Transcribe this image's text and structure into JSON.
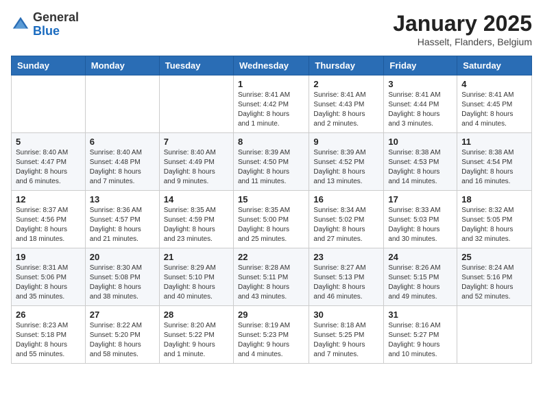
{
  "logo": {
    "general": "General",
    "blue": "Blue"
  },
  "header": {
    "title": "January 2025",
    "subtitle": "Hasselt, Flanders, Belgium"
  },
  "weekdays": [
    "Sunday",
    "Monday",
    "Tuesday",
    "Wednesday",
    "Thursday",
    "Friday",
    "Saturday"
  ],
  "weeks": [
    [
      {
        "day": "",
        "info": ""
      },
      {
        "day": "",
        "info": ""
      },
      {
        "day": "",
        "info": ""
      },
      {
        "day": "1",
        "info": "Sunrise: 8:41 AM\nSunset: 4:42 PM\nDaylight: 8 hours\nand 1 minute."
      },
      {
        "day": "2",
        "info": "Sunrise: 8:41 AM\nSunset: 4:43 PM\nDaylight: 8 hours\nand 2 minutes."
      },
      {
        "day": "3",
        "info": "Sunrise: 8:41 AM\nSunset: 4:44 PM\nDaylight: 8 hours\nand 3 minutes."
      },
      {
        "day": "4",
        "info": "Sunrise: 8:41 AM\nSunset: 4:45 PM\nDaylight: 8 hours\nand 4 minutes."
      }
    ],
    [
      {
        "day": "5",
        "info": "Sunrise: 8:40 AM\nSunset: 4:47 PM\nDaylight: 8 hours\nand 6 minutes."
      },
      {
        "day": "6",
        "info": "Sunrise: 8:40 AM\nSunset: 4:48 PM\nDaylight: 8 hours\nand 7 minutes."
      },
      {
        "day": "7",
        "info": "Sunrise: 8:40 AM\nSunset: 4:49 PM\nDaylight: 8 hours\nand 9 minutes."
      },
      {
        "day": "8",
        "info": "Sunrise: 8:39 AM\nSunset: 4:50 PM\nDaylight: 8 hours\nand 11 minutes."
      },
      {
        "day": "9",
        "info": "Sunrise: 8:39 AM\nSunset: 4:52 PM\nDaylight: 8 hours\nand 13 minutes."
      },
      {
        "day": "10",
        "info": "Sunrise: 8:38 AM\nSunset: 4:53 PM\nDaylight: 8 hours\nand 14 minutes."
      },
      {
        "day": "11",
        "info": "Sunrise: 8:38 AM\nSunset: 4:54 PM\nDaylight: 8 hours\nand 16 minutes."
      }
    ],
    [
      {
        "day": "12",
        "info": "Sunrise: 8:37 AM\nSunset: 4:56 PM\nDaylight: 8 hours\nand 18 minutes."
      },
      {
        "day": "13",
        "info": "Sunrise: 8:36 AM\nSunset: 4:57 PM\nDaylight: 8 hours\nand 21 minutes."
      },
      {
        "day": "14",
        "info": "Sunrise: 8:35 AM\nSunset: 4:59 PM\nDaylight: 8 hours\nand 23 minutes."
      },
      {
        "day": "15",
        "info": "Sunrise: 8:35 AM\nSunset: 5:00 PM\nDaylight: 8 hours\nand 25 minutes."
      },
      {
        "day": "16",
        "info": "Sunrise: 8:34 AM\nSunset: 5:02 PM\nDaylight: 8 hours\nand 27 minutes."
      },
      {
        "day": "17",
        "info": "Sunrise: 8:33 AM\nSunset: 5:03 PM\nDaylight: 8 hours\nand 30 minutes."
      },
      {
        "day": "18",
        "info": "Sunrise: 8:32 AM\nSunset: 5:05 PM\nDaylight: 8 hours\nand 32 minutes."
      }
    ],
    [
      {
        "day": "19",
        "info": "Sunrise: 8:31 AM\nSunset: 5:06 PM\nDaylight: 8 hours\nand 35 minutes."
      },
      {
        "day": "20",
        "info": "Sunrise: 8:30 AM\nSunset: 5:08 PM\nDaylight: 8 hours\nand 38 minutes."
      },
      {
        "day": "21",
        "info": "Sunrise: 8:29 AM\nSunset: 5:10 PM\nDaylight: 8 hours\nand 40 minutes."
      },
      {
        "day": "22",
        "info": "Sunrise: 8:28 AM\nSunset: 5:11 PM\nDaylight: 8 hours\nand 43 minutes."
      },
      {
        "day": "23",
        "info": "Sunrise: 8:27 AM\nSunset: 5:13 PM\nDaylight: 8 hours\nand 46 minutes."
      },
      {
        "day": "24",
        "info": "Sunrise: 8:26 AM\nSunset: 5:15 PM\nDaylight: 8 hours\nand 49 minutes."
      },
      {
        "day": "25",
        "info": "Sunrise: 8:24 AM\nSunset: 5:16 PM\nDaylight: 8 hours\nand 52 minutes."
      }
    ],
    [
      {
        "day": "26",
        "info": "Sunrise: 8:23 AM\nSunset: 5:18 PM\nDaylight: 8 hours\nand 55 minutes."
      },
      {
        "day": "27",
        "info": "Sunrise: 8:22 AM\nSunset: 5:20 PM\nDaylight: 8 hours\nand 58 minutes."
      },
      {
        "day": "28",
        "info": "Sunrise: 8:20 AM\nSunset: 5:22 PM\nDaylight: 9 hours\nand 1 minute."
      },
      {
        "day": "29",
        "info": "Sunrise: 8:19 AM\nSunset: 5:23 PM\nDaylight: 9 hours\nand 4 minutes."
      },
      {
        "day": "30",
        "info": "Sunrise: 8:18 AM\nSunset: 5:25 PM\nDaylight: 9 hours\nand 7 minutes."
      },
      {
        "day": "31",
        "info": "Sunrise: 8:16 AM\nSunset: 5:27 PM\nDaylight: 9 hours\nand 10 minutes."
      },
      {
        "day": "",
        "info": ""
      }
    ]
  ]
}
